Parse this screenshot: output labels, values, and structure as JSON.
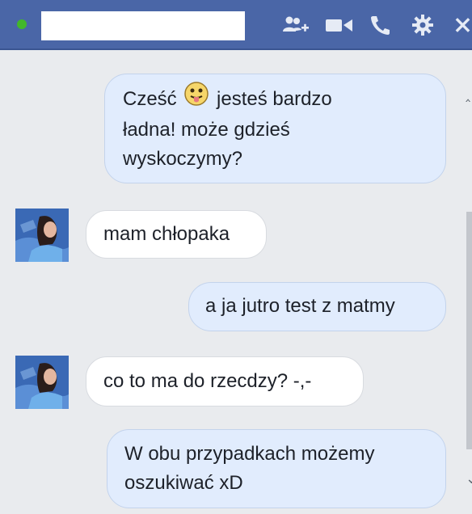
{
  "header": {
    "name_value": "",
    "icons": [
      "add-person-icon",
      "video-camera-icon",
      "phone-icon",
      "gear-icon",
      "close-icon"
    ]
  },
  "messages": [
    {
      "direction": "outgoing",
      "line1_a": "Cześć",
      "line1_b": "jesteś bardzo",
      "line2": "ładna! może gdzieś",
      "line3": "wyskoczymy?",
      "emoji": "tongue-out-emoji"
    },
    {
      "direction": "incoming",
      "text": "mam chłopaka"
    },
    {
      "direction": "outgoing",
      "text": "a ja jutro test z matmy"
    },
    {
      "direction": "incoming",
      "text": "co to ma do rzecdzy? -,-"
    },
    {
      "direction": "outgoing",
      "line1": "W obu przypadkach możemy",
      "line2": "oszukiwać xD"
    }
  ],
  "colors": {
    "titlebar": "#4a66a7",
    "online_dot": "#42b72a",
    "outgoing_bubble": "#e1ecfd",
    "incoming_bubble": "#ffffff",
    "background": "#e9ebee"
  }
}
